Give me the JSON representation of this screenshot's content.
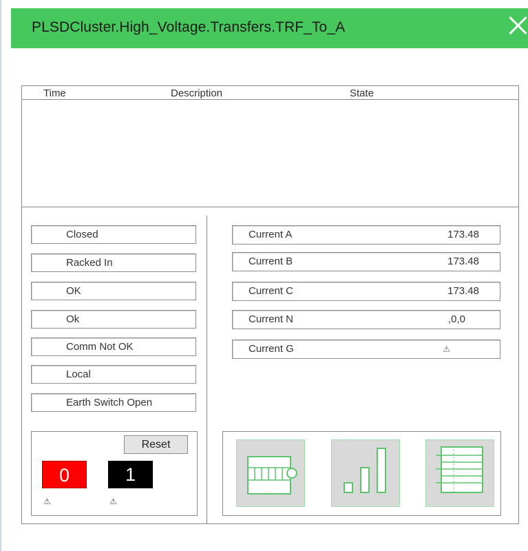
{
  "window": {
    "title": "PLSDCluster.High_Voltage.Transfers.TRF_To_A"
  },
  "alarm_table": {
    "columns": [
      "Time",
      "Description",
      "State"
    ],
    "rows": []
  },
  "status": [
    {
      "label": "Closed"
    },
    {
      "label": "Racked In"
    },
    {
      "label": "OK"
    },
    {
      "label": "Ok"
    },
    {
      "label": "Comm Not OK"
    },
    {
      "label": "Local"
    },
    {
      "label": "Earth Switch Open"
    }
  ],
  "currents": [
    {
      "label": "Current A",
      "value": "173.48"
    },
    {
      "label": "Current B",
      "value": "173.48"
    },
    {
      "label": "Current C",
      "value": "173.48"
    },
    {
      "label": "Current N",
      "value": ",0,0"
    },
    {
      "label": "Current G",
      "value": "⚠"
    }
  ],
  "control": {
    "reset_label": "Reset",
    "open_state": "0",
    "close_state": "1",
    "warning_glyph": "⚠",
    "open_color": "#ff0000",
    "close_color": "#000000"
  },
  "icons": [
    {
      "name": "breaker-view-icon"
    },
    {
      "name": "trend-chart-icon"
    },
    {
      "name": "event-list-icon"
    }
  ],
  "colors": {
    "titlebar": "#47c85d",
    "icon_accent": "#5cc46d",
    "icon_bg": "#d9d9d9"
  }
}
